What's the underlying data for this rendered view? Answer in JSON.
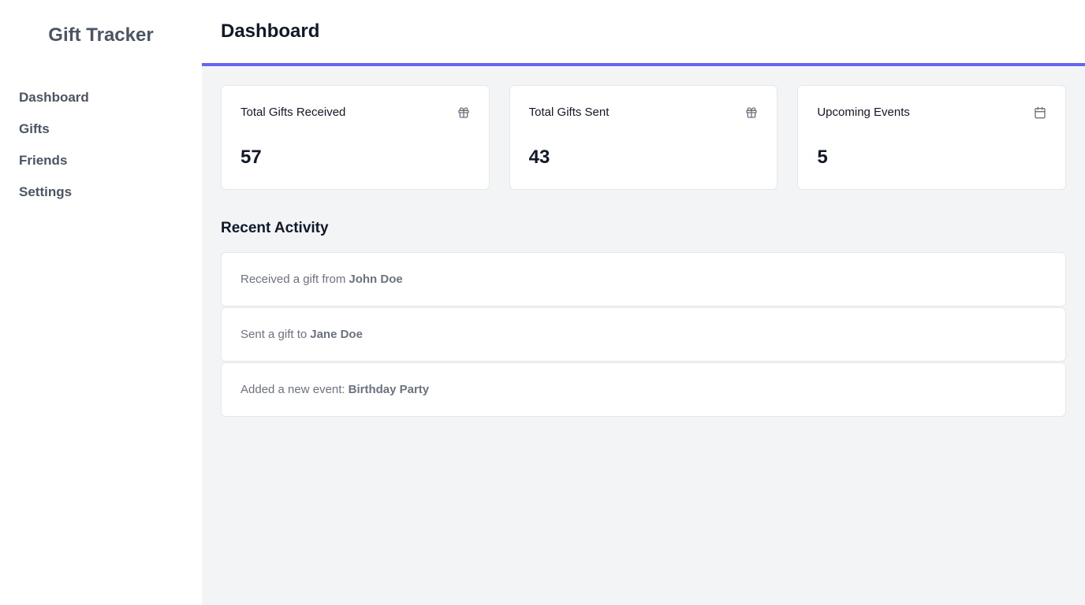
{
  "app": {
    "title": "Gift Tracker",
    "accent_color": "#6366f1"
  },
  "sidebar": {
    "items": [
      {
        "label": "Dashboard"
      },
      {
        "label": "Gifts"
      },
      {
        "label": "Friends"
      },
      {
        "label": "Settings"
      }
    ]
  },
  "header": {
    "title": "Dashboard"
  },
  "stats": [
    {
      "label": "Total Gifts Received",
      "value": "57",
      "icon": "gift-icon"
    },
    {
      "label": "Total Gifts Sent",
      "value": "43",
      "icon": "gift-icon"
    },
    {
      "label": "Upcoming Events",
      "value": "5",
      "icon": "calendar-icon"
    }
  ],
  "recent_activity": {
    "title": "Recent Activity",
    "items": [
      {
        "text": "Received a gift from",
        "highlight": "John Doe"
      },
      {
        "text": "Sent a gift to",
        "highlight": "Jane Doe"
      },
      {
        "text": "Added a new event:",
        "highlight": "Birthday Party"
      }
    ]
  }
}
